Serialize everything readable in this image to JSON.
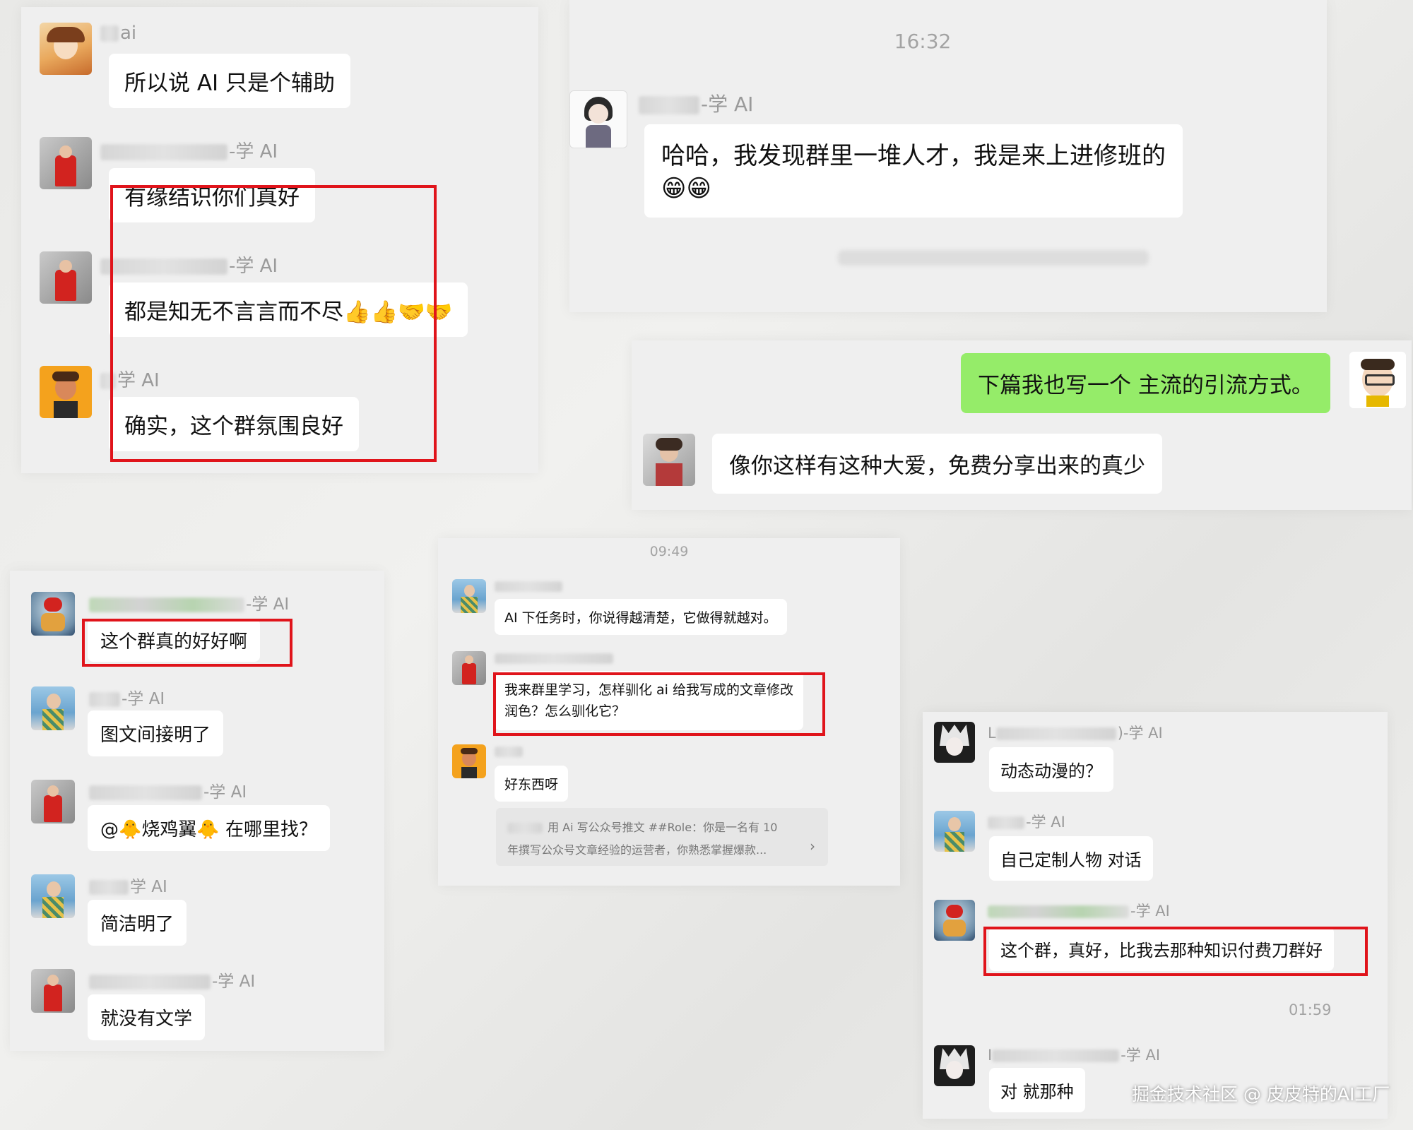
{
  "colors": {
    "bubble_me": "#95ec69",
    "bubble_other": "#ffffff",
    "highlight_box": "#e0141b",
    "name_text": "#9a9a9a"
  },
  "panel1": {
    "messages": [
      {
        "name_suffix": "ai",
        "text": "所以说 AI 只是个辅助"
      },
      {
        "name_suffix": "-学 AI",
        "text": "有缘结识你们真好"
      },
      {
        "name_suffix": "-学 AI",
        "text": "都是知无不言言而不尽"
      },
      {
        "name_suffix": "学 AI",
        "text": "确实，这个群氛围良好"
      }
    ]
  },
  "panel2": {
    "time": "16:32",
    "messages": [
      {
        "name_suffix": "-学 AI",
        "text": "哈哈，我发现群里一堆人才，我是来上进修班的"
      }
    ]
  },
  "panel3": {
    "messages": [
      {
        "text": "下篇我也写一个 主流的引流方式。"
      },
      {
        "text": "像你这样有这种大爱，免费分享出来的真少"
      }
    ]
  },
  "panel4": {
    "messages": [
      {
        "name_suffix": "-学 AI",
        "text": "这个群真的好好啊"
      },
      {
        "name_suffix": "-学 AI",
        "text": "图文间接明了"
      },
      {
        "name_suffix": "-学 AI",
        "text": "在哪里找？",
        "prefix": "@",
        "mention": "烧鸡翼"
      },
      {
        "name_suffix": "学 AI",
        "text": "简洁明了"
      },
      {
        "name_suffix": "-学 AI",
        "text": "就没有文学"
      }
    ]
  },
  "panel5": {
    "time": "09:49",
    "messages": [
      {
        "text": "AI 下任务时，你说得越清楚，它做得就越对。"
      },
      {
        "text_line1": "我来群里学习，怎样驯化 ai 给我写成的文章修改",
        "text_line2": "润色？怎么驯化它？"
      },
      {
        "text": "好东西呀"
      }
    ],
    "link_card": {
      "line1": "用 Ai 写公众号推文  ##Role：你是一名有 10",
      "line2": "年撰写公众号文章经验的运营者，你熟悉掌握爆款...",
      "arrow": "›"
    }
  },
  "panel6": {
    "time": "01:59",
    "messages": [
      {
        "name_prefix": "L",
        "name_suffix": ")-学 AI",
        "text": "动态动漫的？"
      },
      {
        "name_suffix": "-学 AI",
        "text": "自己定制人物 对话"
      },
      {
        "name_suffix": "-学 AI",
        "text": "这个群，真好，比我去那种知识付费刀群好"
      },
      {
        "name_prefix": "I",
        "name_suffix": "-学 AI",
        "text": "对 就那种"
      }
    ]
  },
  "watermark": "掘金技术社区 @ 皮皮特的AI工厂"
}
